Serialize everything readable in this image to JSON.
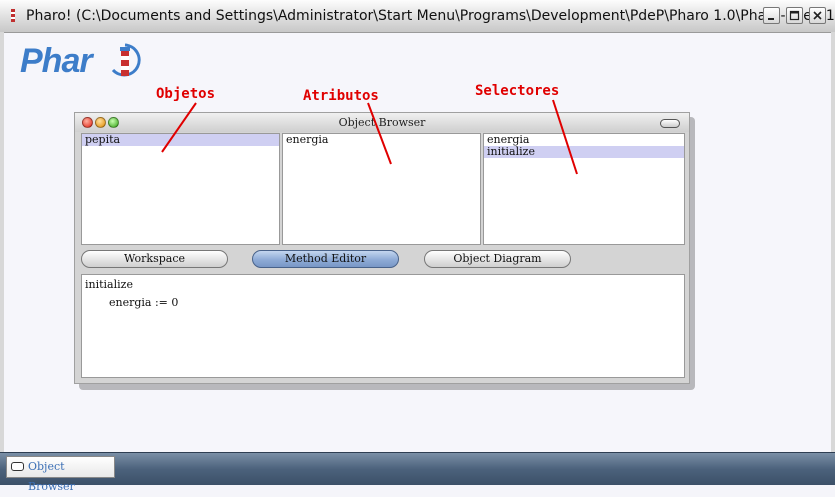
{
  "window": {
    "title": "Pharo! (C:\\Documents and Settings\\Administrator\\Start Menu\\Programs\\Development\\PdeP\\Pharo 1.0\\Pharo-pdep-1...",
    "controls": [
      "minimize",
      "maximize",
      "close"
    ]
  },
  "logo": {
    "text": "Phar"
  },
  "annotations": {
    "objetos": "Objetos",
    "atributos": "Atributos",
    "selectores": "Selectores",
    "color": "#e00000"
  },
  "object_browser": {
    "title": "Object Browser",
    "objects_pane": {
      "items": [
        "pepita"
      ],
      "selected": "pepita"
    },
    "attributes_pane": {
      "items": [
        "energia"
      ],
      "selected": null
    },
    "selectors_pane": {
      "items": [
        "energia",
        "initialize"
      ],
      "selected": "initialize"
    },
    "buttons": {
      "workspace": "Workspace",
      "method_editor": "Method Editor",
      "object_diagram": "Object Diagram",
      "active": "Method Editor"
    },
    "editor": {
      "line1": "initialize",
      "line2": "energia := 0"
    }
  },
  "taskbar": {
    "items": [
      {
        "label": "Object Browser"
      }
    ]
  }
}
